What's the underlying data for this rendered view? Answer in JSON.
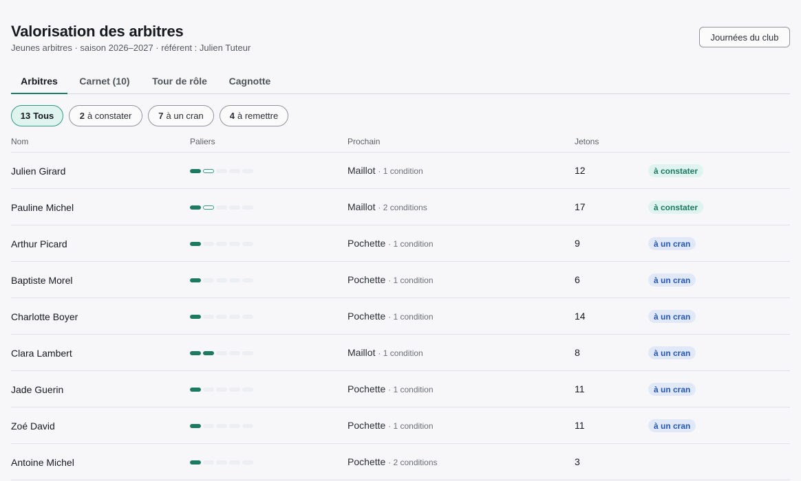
{
  "header": {
    "title": "Valorisation des arbitres",
    "subtitle": "Jeunes arbitres · saison 2026–2027 · référent : Julien Tuteur",
    "club_button": "Journées du club"
  },
  "tabs": [
    {
      "label": "Arbitres",
      "active": true
    },
    {
      "label": "Carnet (10)",
      "active": false
    },
    {
      "label": "Tour de rôle",
      "active": false
    },
    {
      "label": "Cagnotte",
      "active": false
    }
  ],
  "filters": [
    {
      "count": "13",
      "label": "Tous",
      "active": true
    },
    {
      "count": "2",
      "label": "à constater",
      "active": false
    },
    {
      "count": "7",
      "label": "à un cran",
      "active": false
    },
    {
      "count": "4",
      "label": "à remettre",
      "active": false
    }
  ],
  "table": {
    "columns": {
      "name": "Nom",
      "tiers": "Paliers",
      "next": "Prochain",
      "tokens": "Jetons"
    },
    "tier_total": 5,
    "rows": [
      {
        "name": "Julien Girard",
        "tiers_done": 1,
        "tier_in_progress": true,
        "next": "Maillot",
        "conditions": "· 1 condition",
        "tokens": "12",
        "status": "à constater",
        "status_kind": "constater"
      },
      {
        "name": "Pauline Michel",
        "tiers_done": 1,
        "tier_in_progress": true,
        "next": "Maillot",
        "conditions": "· 2 conditions",
        "tokens": "17",
        "status": "à constater",
        "status_kind": "constater"
      },
      {
        "name": "Arthur Picard",
        "tiers_done": 1,
        "tier_in_progress": false,
        "next": "Pochette",
        "conditions": "· 1 condition",
        "tokens": "9",
        "status": "à un cran",
        "status_kind": "cran"
      },
      {
        "name": "Baptiste Morel",
        "tiers_done": 1,
        "tier_in_progress": false,
        "next": "Pochette",
        "conditions": "· 1 condition",
        "tokens": "6",
        "status": "à un cran",
        "status_kind": "cran"
      },
      {
        "name": "Charlotte Boyer",
        "tiers_done": 1,
        "tier_in_progress": false,
        "next": "Pochette",
        "conditions": "· 1 condition",
        "tokens": "14",
        "status": "à un cran",
        "status_kind": "cran"
      },
      {
        "name": "Clara Lambert",
        "tiers_done": 2,
        "tier_in_progress": false,
        "next": "Maillot",
        "conditions": "· 1 condition",
        "tokens": "8",
        "status": "à un cran",
        "status_kind": "cran"
      },
      {
        "name": "Jade Guerin",
        "tiers_done": 1,
        "tier_in_progress": false,
        "next": "Pochette",
        "conditions": "· 1 condition",
        "tokens": "11",
        "status": "à un cran",
        "status_kind": "cran"
      },
      {
        "name": "Zoé David",
        "tiers_done": 1,
        "tier_in_progress": false,
        "next": "Pochette",
        "conditions": "· 1 condition",
        "tokens": "11",
        "status": "à un cran",
        "status_kind": "cran"
      },
      {
        "name": "Antoine Michel",
        "tiers_done": 1,
        "tier_in_progress": false,
        "next": "Pochette",
        "conditions": "· 2 conditions",
        "tokens": "3",
        "status": "",
        "status_kind": ""
      }
    ]
  },
  "colors": {
    "accent": "#1e7d66",
    "tier_done": "#1b7a5f",
    "tier_empty": "#eceef1",
    "badge_constater_bg": "#dff3ef",
    "badge_cran_bg": "#e1e9f8"
  }
}
